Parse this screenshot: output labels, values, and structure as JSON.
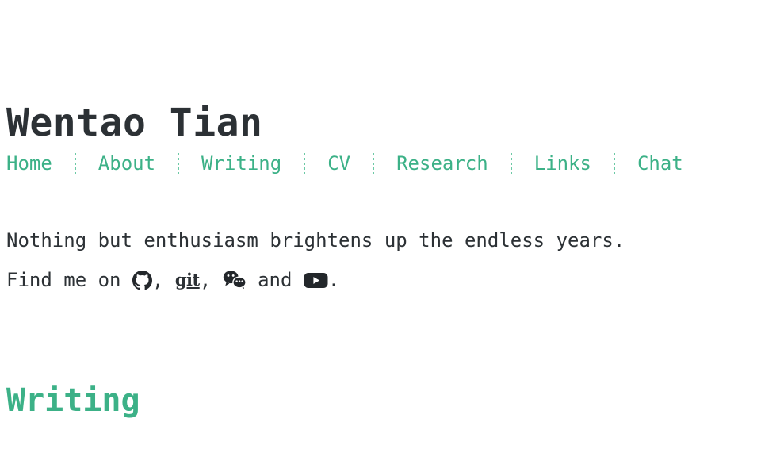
{
  "site": {
    "title": "Wentao Tian",
    "accent_color": "#3cb187",
    "text_color": "#2c3135",
    "background_color": "#ffffff"
  },
  "nav": {
    "items": [
      {
        "label": "Home"
      },
      {
        "label": "About"
      },
      {
        "label": "Writing"
      },
      {
        "label": "CV"
      },
      {
        "label": "Research"
      },
      {
        "label": "Links"
      },
      {
        "label": "Chat"
      }
    ],
    "separator": "dotted-vertical-rule"
  },
  "intro": {
    "tagline": "Nothing but enthusiasm brightens up the endless years.",
    "find_me_prefix": "Find me on ",
    "after_github": ", ",
    "git_label": "git",
    "after_git": ", ",
    "conjunction": " and ",
    "period": ".",
    "links": [
      {
        "name": "github-icon",
        "label": "GitHub"
      },
      {
        "name": "git-wordmark",
        "label": "git"
      },
      {
        "name": "wechat-icon",
        "label": "WeChat"
      },
      {
        "name": "youtube-icon",
        "label": "YouTube"
      }
    ]
  },
  "sections": [
    {
      "heading": "Writing"
    }
  ]
}
